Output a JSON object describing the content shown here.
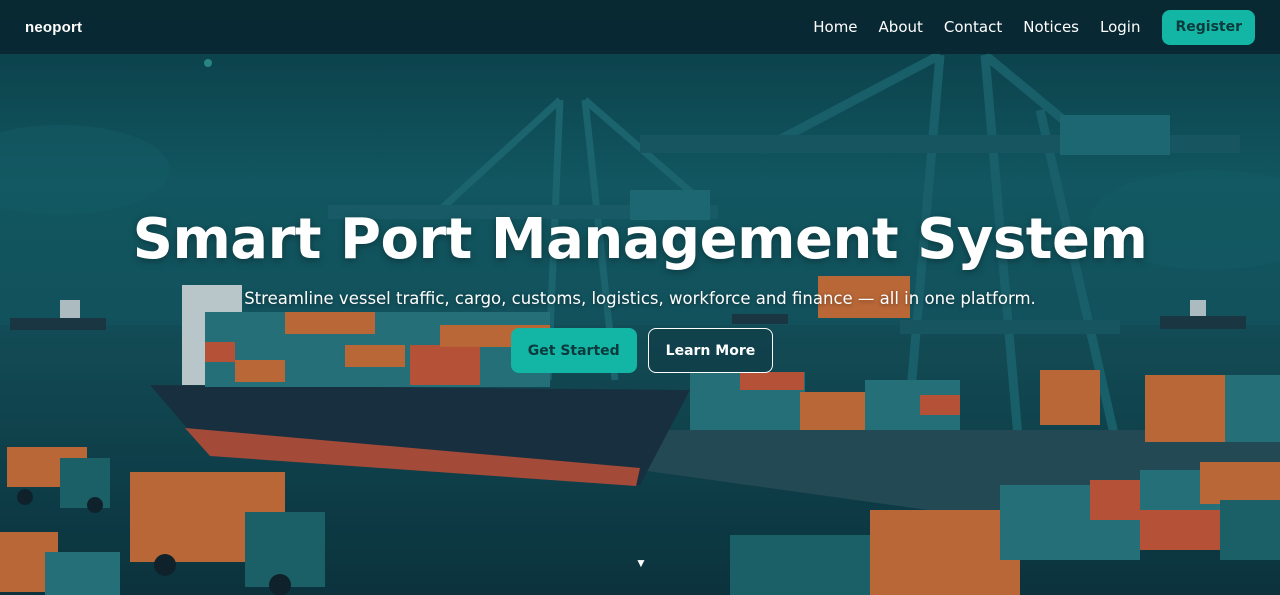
{
  "nav": {
    "brand": "neoport",
    "links": [
      "Home",
      "About",
      "Contact",
      "Notices",
      "Login"
    ],
    "register_label": "Register"
  },
  "hero": {
    "title": "Smart Port Management System",
    "subtitle": "Streamline vessel traffic, cargo, customs, logistics, workforce and finance — all in one platform.",
    "primary_cta": "Get Started",
    "secondary_cta": "Learn More",
    "scroll_icon": "▼"
  },
  "colors": {
    "accent": "#13b5a4",
    "nav_bg": "#082630",
    "sky": "#0f5560",
    "water": "#113f4a"
  }
}
